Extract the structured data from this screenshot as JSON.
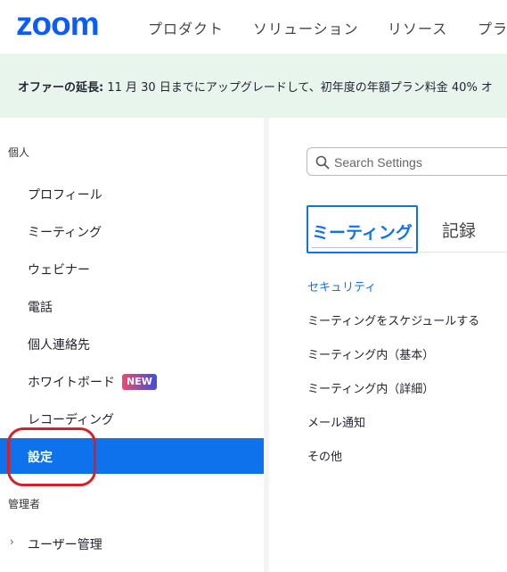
{
  "header": {
    "logo_text": "zoom",
    "nav": [
      "プロダクト",
      "ソリューション",
      "リソース",
      "プラ"
    ]
  },
  "promo": {
    "label": "オファーの延長:",
    "text": " 11 月 30 日までにアップグレードして、初年度の年額プラン料金 40% オ"
  },
  "sidebar": {
    "personal_header": "個人",
    "items": [
      {
        "label": "プロフィール"
      },
      {
        "label": "ミーティング"
      },
      {
        "label": "ウェビナー"
      },
      {
        "label": "電話"
      },
      {
        "label": "個人連絡先"
      },
      {
        "label": "ホワイトボード",
        "badge": "NEW"
      },
      {
        "label": "レコーディング"
      },
      {
        "label": "設定",
        "active": true
      }
    ],
    "admin_header": "管理者",
    "admin_items": [
      {
        "label": "ユーザー管理",
        "icon": "chevron-right-icon"
      }
    ]
  },
  "main": {
    "search": {
      "placeholder": "Search Settings",
      "icon": "search-icon"
    },
    "tabs": [
      {
        "label": "ミーティング",
        "active": true
      },
      {
        "label": "記録"
      }
    ],
    "sections": [
      {
        "label": "セキュリティ",
        "active": true
      },
      {
        "label": "ミーティングをスケジュールする"
      },
      {
        "label": "ミーティング内（基本）"
      },
      {
        "label": "ミーティング内（詳細）"
      },
      {
        "label": "メール通知"
      },
      {
        "label": "その他"
      }
    ]
  },
  "colors": {
    "accent": "#0e72ed",
    "promo_bg": "#e8f5ec",
    "annotation": "#d6202a"
  }
}
